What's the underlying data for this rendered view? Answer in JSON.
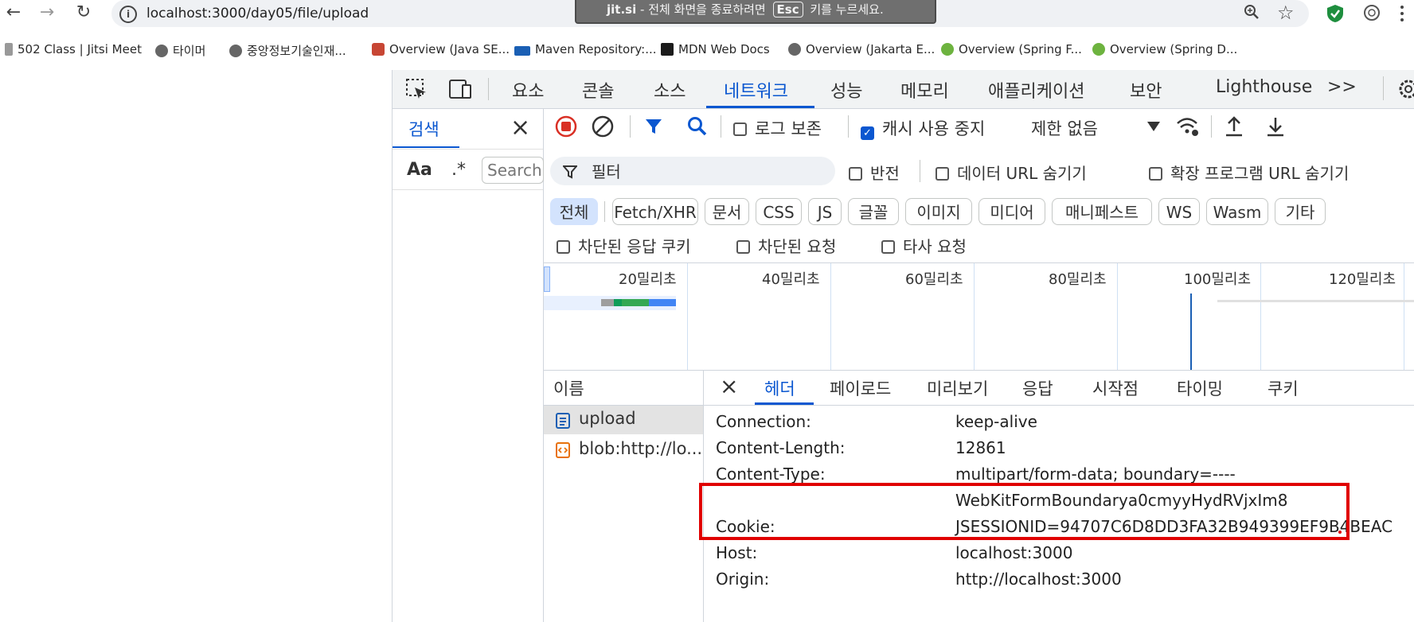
{
  "browser": {
    "url": "localhost:3000/day05/file/upload",
    "fullscreen_banner": {
      "site": "jit.si",
      "message_before": "- 전체 화면을 종료하려면",
      "key": "Esc",
      "message_after": "키를 누르세요."
    },
    "bookmarks": [
      {
        "label": "502 Class | Jitsi Meet",
        "icon": "pen-icon",
        "color": "#777777"
      },
      {
        "label": "타이머",
        "icon": "globe-icon",
        "color": "#555555"
      },
      {
        "label": "중앙정보기술인재...",
        "icon": "globe-icon",
        "color": "#555555"
      },
      {
        "label": "Overview (Java SE...",
        "icon": "oracle-icon",
        "color": "#c74634"
      },
      {
        "label": "Maven Repository:...",
        "icon": "maven-icon",
        "color": "#1a5fb4"
      },
      {
        "label": "MDN Web Docs",
        "icon": "mdn-icon",
        "color": "#1b1b1b"
      },
      {
        "label": "Overview (Jakarta E...",
        "icon": "globe-icon",
        "color": "#555555"
      },
      {
        "label": "Overview (Spring F...",
        "icon": "spring-icon",
        "color": "#6db33f"
      },
      {
        "label": "Overview (Spring D...",
        "icon": "spring-icon",
        "color": "#6db33f"
      }
    ]
  },
  "devtools": {
    "tabs": [
      "요소",
      "콘솔",
      "소스",
      "네트워크",
      "성능",
      "메모리",
      "애플리케이션",
      "보안",
      "Lighthouse"
    ],
    "active_tab": "네트워크",
    "more_tabs_label": ">>",
    "search_pane": {
      "tab_label": "검색",
      "case_label": "Aa",
      "regex_label": ".*",
      "placeholder": "Search"
    },
    "network": {
      "preserve_log_label": "로그 보존",
      "preserve_log_checked": false,
      "disable_cache_label": "캐시 사용 중지",
      "disable_cache_checked": true,
      "throttling_label": "제한 없음",
      "filter_placeholder": "필터",
      "invert_label": "반전",
      "hide_data_urls_label": "데이터 URL 숨기기",
      "hide_ext_urls_label": "확장 프로그램 URL 숨기기",
      "type_filters": [
        "전체",
        "Fetch/XHR",
        "문서",
        "CSS",
        "JS",
        "글꼴",
        "이미지",
        "미디어",
        "매니페스트",
        "WS",
        "Wasm",
        "기타"
      ],
      "active_type_filter": "전체",
      "blocked_cookies_label": "차단된 응답 쿠키",
      "blocked_requests_label": "차단된 요청",
      "third_party_label": "타사 요청",
      "timeline_ticks": [
        "20밀리초",
        "40밀리초",
        "60밀리초",
        "80밀리초",
        "100밀리초",
        "120밀리초"
      ],
      "name_column": "이름",
      "requests": [
        {
          "name": "upload",
          "icon": "document-icon",
          "selected": true
        },
        {
          "name": "blob:http://lo...",
          "icon": "code-icon",
          "selected": false
        }
      ],
      "detail_tabs": [
        "헤더",
        "페이로드",
        "미리보기",
        "응답",
        "시작점",
        "타이밍",
        "쿠키"
      ],
      "active_detail_tab": "헤더",
      "headers": [
        {
          "name": "Connection:",
          "value": "keep-alive"
        },
        {
          "name": "Content-Length:",
          "value": "12861"
        },
        {
          "name": "Content-Type:",
          "value": "multipart/form-data; boundary=----",
          "value2": "WebKitFormBoundarya0cmyyHydRVjxIm8"
        },
        {
          "name": "Cookie:",
          "value": "JSESSIONID=94707C6D8DD3FA32B949399EF9B4BEAC"
        },
        {
          "name": "Host:",
          "value": "localhost:3000"
        },
        {
          "name": "Origin:",
          "value": "http://localhost:3000"
        }
      ]
    }
  },
  "colors": {
    "accent": "#0b57d0",
    "highlight": "#e00000",
    "record": "#d93025"
  }
}
